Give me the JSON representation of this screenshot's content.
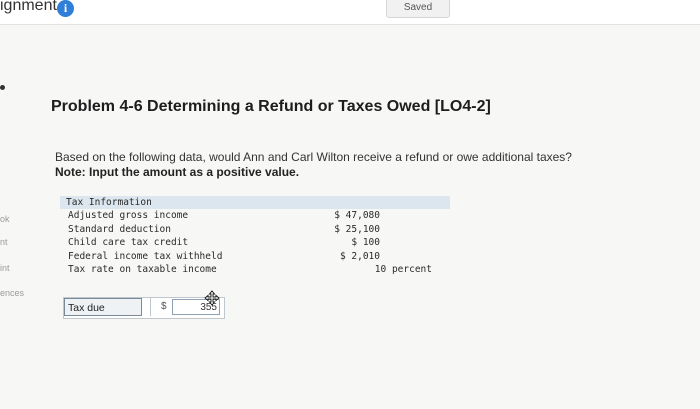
{
  "header": {
    "assignment_title": "ignment",
    "info_glyph": "i",
    "saved_label": "Saved"
  },
  "left_rail": {
    "items": [
      "ok",
      "nt",
      "int",
      "ences"
    ]
  },
  "problem": {
    "title": "Problem 4-6 Determining a Refund or Taxes Owed [LO4-2]",
    "question": "Based on the following data, would Ann and Carl Wilton receive a refund or owe additional taxes?",
    "note": "Note: Input the amount as a positive value."
  },
  "tax_table": {
    "header": "Tax Information",
    "rows": [
      {
        "label": "Adjusted gross income",
        "value": "$ 47,080"
      },
      {
        "label": "Standard deduction",
        "value": "$ 25,100"
      },
      {
        "label": "Child care tax credit",
        "value": "$ 100"
      },
      {
        "label": "Federal income tax withheld",
        "value": "$ 2,010"
      },
      {
        "label": "Tax rate on taxable income",
        "value": "10 percent"
      }
    ]
  },
  "answer": {
    "label": "Tax due",
    "currency": "$",
    "value": "355"
  },
  "icons": {
    "info": "info-icon",
    "cursor": "move-cursor-icon"
  },
  "colors": {
    "info_blue": "#2f7fd8",
    "table_header_bg": "#dbe6ee"
  }
}
